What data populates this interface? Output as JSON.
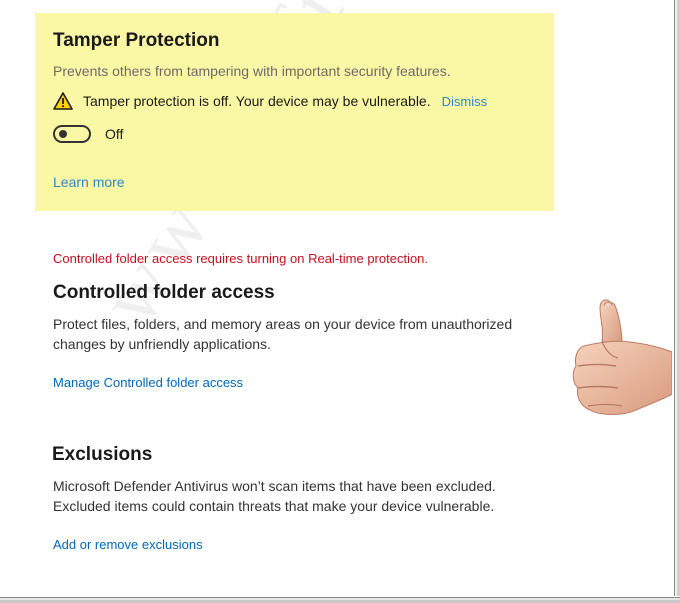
{
  "tamper": {
    "title": "Tamper Protection",
    "description": "Prevents others from tampering with important security features.",
    "warning": "Tamper protection is off. Your device may be vulnerable.",
    "dismiss_label": "Dismiss",
    "toggle_state": "Off",
    "learn_more_label": "Learn more"
  },
  "controlled_folder": {
    "warning": "Controlled folder access requires turning on Real-time protection.",
    "title": "Controlled folder access",
    "body_line1": "Protect files, folders, and memory areas on your device from unauthorized",
    "body_line2": "changes by unfriendly applications.",
    "link_label": "Manage Controlled folder access"
  },
  "exclusions": {
    "title": "Exclusions",
    "body_line1": "Microsoft Defender Antivirus won’t scan items that have been excluded.",
    "body_line2": "Excluded items could contain threats that make your device vulnerable.",
    "link_label": "Add or remove exclusions"
  },
  "watermark": "www.SoftwareOK.com",
  "colors": {
    "highlight": "#fbf8a5",
    "link": "#0067b8",
    "warning_text": "#c50f1f"
  }
}
